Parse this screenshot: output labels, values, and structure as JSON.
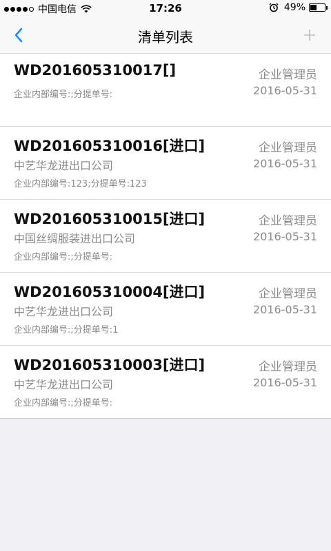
{
  "status_bar": {
    "carrier": "中国电信",
    "time": "17:26",
    "battery": "49%",
    "battery_level": 0.49
  },
  "nav": {
    "title": "清单列表"
  },
  "colors": {
    "accent": "#1a8cff",
    "secondary_text": "#8a8a8a"
  },
  "list": {
    "items": [
      {
        "title": "WD201605310017[]",
        "company": "",
        "numbers": "企业内部编号:;分提单号:",
        "role": "企业管理员",
        "date": "2016-05-31"
      },
      {
        "title": "WD201605310016[进口]",
        "company": "中艺华龙进出口公司",
        "numbers": "企业内部编号:123;分提单号:123",
        "role": "企业管理员",
        "date": "2016-05-31"
      },
      {
        "title": "WD201605310015[进口]",
        "company": "中国丝绸服装进出口公司",
        "numbers": "企业内部编号:;分提单号:",
        "role": "企业管理员",
        "date": "2016-05-31"
      },
      {
        "title": "WD201605310004[进口]",
        "company": "中艺华龙进出口公司",
        "numbers": "企业内部编号:;分提单号:1",
        "role": "企业管理员",
        "date": "2016-05-31"
      },
      {
        "title": "WD201605310003[进口]",
        "company": "中艺华龙进出口公司",
        "numbers": "企业内部编号:;分提单号:",
        "role": "企业管理员",
        "date": "2016-05-31"
      }
    ]
  }
}
